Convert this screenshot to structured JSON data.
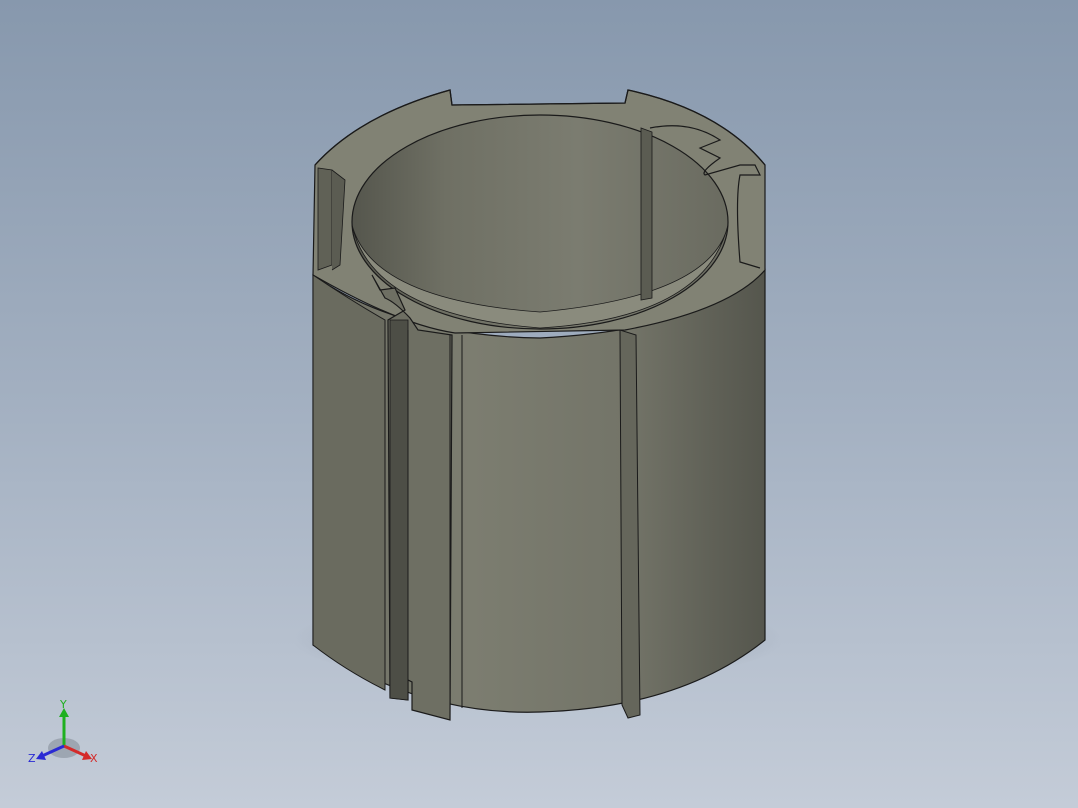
{
  "viewport": {
    "background_top": "#8798ad",
    "background_bottom": "#c4ccd8"
  },
  "model": {
    "part_type": "aluminium-profile-cylinder-tube",
    "body_color": "#7a7b6e",
    "edge_color": "#1a1a1a"
  },
  "triad": {
    "y_label": "Y",
    "x_label": "X",
    "z_label": "Z",
    "y_color": "#1fb01f",
    "x_color": "#d42a2a",
    "z_color": "#2a2ad4"
  }
}
